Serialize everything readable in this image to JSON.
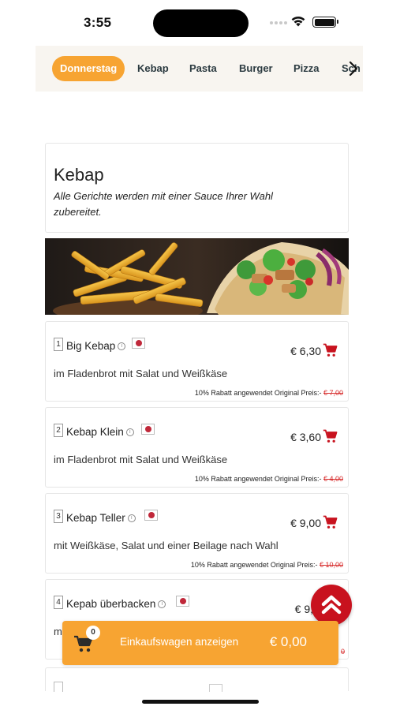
{
  "status_bar": {
    "time": "3:55"
  },
  "categories": [
    {
      "label": "Donnerstag",
      "active": true
    },
    {
      "label": "Kebap",
      "active": false
    },
    {
      "label": "Pasta",
      "active": false
    },
    {
      "label": "Burger",
      "active": false
    },
    {
      "label": "Pizza",
      "active": false
    },
    {
      "label": "Sch",
      "active": false
    }
  ],
  "section": {
    "title": "Kebap",
    "description": "Alle Gerichte werden mit einer Sauce Ihrer Wahl zubereitet."
  },
  "items": [
    {
      "number": "1",
      "name": "Big Kebap",
      "price": "€ 6,30",
      "description": "im Fladenbrot mit Salat und Weißkäse",
      "discount_text": "10% Rabatt angewendet Original Preis:-",
      "original_price": "€ 7,00"
    },
    {
      "number": "2",
      "name": "Kebap Klein",
      "price": "€ 3,60",
      "description": "im Fladenbrot mit Salat und Weißkäse",
      "discount_text": "10% Rabatt angewendet Original Preis:-",
      "original_price": "€ 4,00"
    },
    {
      "number": "3",
      "name": "Kebap Teller",
      "price": "€ 9,00",
      "description": "mit Weißkäse, Salat und einer Beilage nach Wahl",
      "discount_text": "10% Rabatt angewendet Original Preis:-",
      "original_price": "€ 10,00"
    },
    {
      "number": "4",
      "name": "Kepab überbacken",
      "price": "€ 9,",
      "description": "m",
      "discount_text": "",
      "original_price": "0"
    }
  ],
  "cart": {
    "count": "0",
    "label": "Einkaufswagen anzeigen",
    "total": "€ 0,00"
  },
  "colors": {
    "accent": "#f7a432",
    "brand_red": "#c8121e",
    "strike_red": "#d62828"
  },
  "icons": {
    "info": "ⓘ",
    "next": "chevron-right-icon",
    "cart": "shopping-cart-icon",
    "scroll_top": "double-chevron-up-icon"
  }
}
